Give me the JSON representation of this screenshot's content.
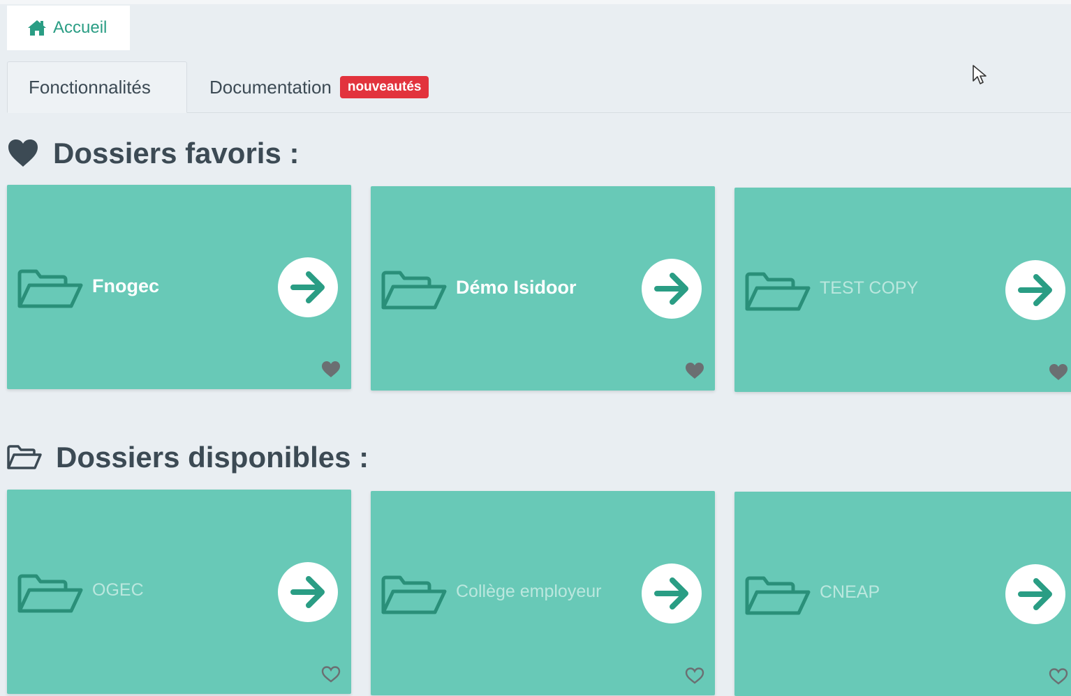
{
  "breadcrumb": {
    "home_label": "Accueil",
    "icon": "home-icon"
  },
  "tabs": [
    {
      "label": "Fonctionnalités",
      "active": true
    },
    {
      "label": "Documentation",
      "badge": "nouveautés",
      "active": false
    }
  ],
  "colors": {
    "accent": "#2a9d84",
    "card": "#68c9b7",
    "folder_icon": "#2a8f79",
    "badge": "#e2333d",
    "heading": "#3c4a54"
  },
  "favorites": {
    "title": "Dossiers favoris :",
    "icon": "heart-icon",
    "cards": [
      {
        "label": "Fnogec",
        "favorite": true
      },
      {
        "label": "Démo Isidoor",
        "favorite": true
      },
      {
        "label": "TEST COPY",
        "favorite": true
      }
    ]
  },
  "available": {
    "title": "Dossiers disponibles :",
    "icon": "folder-open-icon",
    "cards": [
      {
        "label": "OGEC",
        "favorite": false
      },
      {
        "label": "Collège employeur",
        "favorite": false
      },
      {
        "label": "CNEAP",
        "favorite": false
      }
    ]
  }
}
